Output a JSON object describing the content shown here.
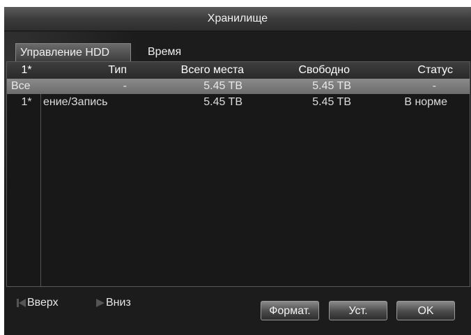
{
  "window": {
    "title": "Хранилище"
  },
  "tabs": [
    {
      "label": "Управление HDD",
      "active": true
    },
    {
      "label": "Время записи",
      "active": false
    }
  ],
  "table": {
    "columns": [
      "1*",
      "Тип",
      "Всего места",
      "Свободно",
      "Статус"
    ],
    "rows": [
      {
        "id": "Все",
        "type": "-",
        "total": "5.45 TB",
        "free": "5.45 TB",
        "status": "-",
        "selected": true
      },
      {
        "id": "1*",
        "type": "ение/Запись",
        "total": "5.45 TB",
        "free": "5.45 TB",
        "status": "В норме",
        "selected": false
      }
    ]
  },
  "pager": {
    "up_label": "Вверх",
    "down_label": "Вниз"
  },
  "buttons": {
    "format": "Формат.",
    "set": "Уст.",
    "ok": "OK"
  },
  "colors": {
    "window_bg": "#1c1c1c",
    "selection": "#7a7a7a",
    "text": "#f0f0f0"
  },
  "icons": {
    "up": "skip-back-icon",
    "down": "play-icon"
  }
}
